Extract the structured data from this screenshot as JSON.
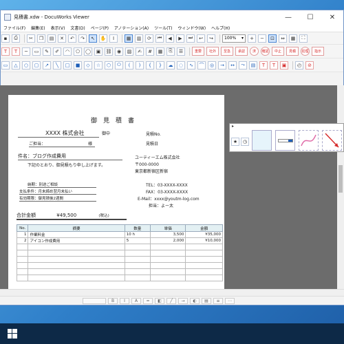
{
  "window": {
    "title": "見積書.xdw - DocuWorks Viewer",
    "min_glyph": "—",
    "max_glyph": "☐",
    "close_glyph": "✕"
  },
  "menu": [
    "ファイル(F)",
    "編集(E)",
    "表示(V)",
    "文書(D)",
    "ページ(P)",
    "アノテーション(A)",
    "ツール(T)",
    "ウィンドウ(W)",
    "ヘルプ(H)"
  ],
  "toolbar": {
    "zoom_value": "100%",
    "stamps": [
      "重要",
      "社外",
      "至急",
      "承認",
      "済",
      "確認",
      "中止",
      "見積",
      "処理",
      "指示"
    ]
  },
  "document": {
    "title": "御見積書",
    "customer": "XXXX 株式会社",
    "honorific": "御中",
    "estimate_no_label": "見積No.",
    "estimate_date_label": "見積日",
    "person_label": "ご担当：",
    "person_honorific": "様",
    "subject_label": "件名：",
    "subject": "ブログ作成費用",
    "intro": "下記のとおり、御見積もり申し上げます。",
    "company_name": "ユーティーエム株式会社",
    "postal": "〒000-0000",
    "address": "東京都新宿区新宿",
    "tel_label": "TEL：",
    "tel": "03-XXXX-XXXX",
    "fax_label": "FAX：",
    "fax": "03-XXXX-XXXX",
    "email_label": "E-Mail：",
    "email": "xxxx@youtm-log.com",
    "staff_label": "担当：",
    "staff": "よー太",
    "delivery_label": "納期：",
    "delivery": "別途ご相談",
    "payment_label": "支払条件：",
    "payment": "月末締め翌月末払い",
    "validity_label": "有効期限：",
    "validity": "御見積後2週間",
    "total_label": "合計金額",
    "total": "¥49,500",
    "tax_note": "(税込)",
    "table": {
      "headers": [
        "No.",
        "摘要",
        "数量",
        "単価",
        "金額"
      ],
      "rows": [
        [
          "1",
          "作業料金",
          "10 h",
          "3,500",
          "¥35,000"
        ],
        [
          "2",
          "アイコン作成費用",
          "5",
          "2,000",
          "¥10,000"
        ]
      ]
    }
  },
  "palette": {
    "title": "▸"
  }
}
